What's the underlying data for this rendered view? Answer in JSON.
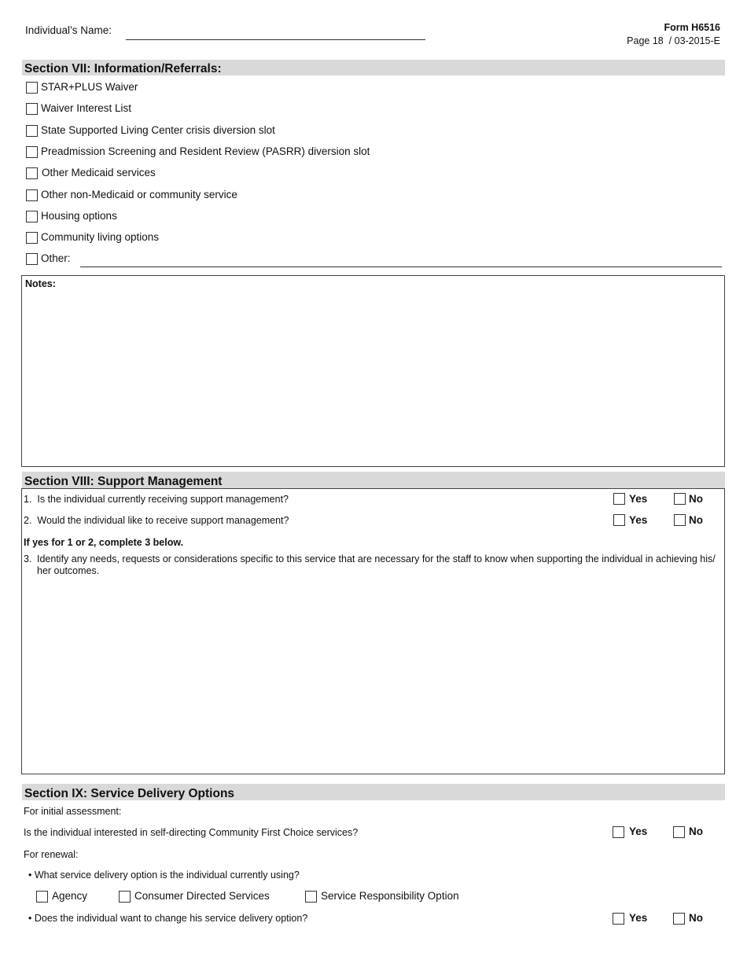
{
  "header": {
    "name_label": "Individual’s Name:",
    "name_value": "",
    "form_number": "Form H6516",
    "page_info": "Page 18  / 03-2015-E"
  },
  "section7": {
    "title": "Section VII: Information/Referrals:",
    "items": [
      {
        "label": "STAR+PLUS Waiver",
        "checked": false
      },
      {
        "label": "Waiver Interest List",
        "checked": false
      },
      {
        "label": "State Supported Living Center crisis diversion slot",
        "checked": false
      },
      {
        "label": "Preadmission Screening and Resident Review (PASRR) diversion slot",
        "checked": false
      },
      {
        "label": "Other Medicaid services",
        "checked": false
      },
      {
        "label": "Other non-Medicaid or community service",
        "checked": false
      },
      {
        "label": "Housing options",
        "checked": false
      },
      {
        "label": "Community living options",
        "checked": false
      }
    ],
    "other_label": "Other:",
    "other_value": "",
    "notes_label": "Notes:",
    "notes_value": ""
  },
  "section8": {
    "title": "Section VIII: Support Management",
    "questions": [
      {
        "text": "1.  Is the individual currently receiving support management?",
        "yes": "Yes",
        "no": "No"
      },
      {
        "text": "2.  Would the individual like to receive support management?",
        "yes": "Yes",
        "no": "No"
      }
    ],
    "instruction": "If yes for 1 or 2, complete 3 below.",
    "q3_number": "3.",
    "q3_text": "Identify any needs, requests or considerations specific to this service that are necessary for the staff to know when supporting the individual in achieving his/ her outcomes.",
    "q3_value": ""
  },
  "section9": {
    "title": "Section IX: Service Delivery Options",
    "initial_label": "For initial assessment:",
    "initial_question": "Is the individual interested in self-directing Community First Choice services?",
    "renewal_label": "For renewal:",
    "current_question": "• What service delivery option is the individual currently using?",
    "options": [
      "Agency",
      "Consumer Directed Services",
      "Service Responsibility Option"
    ],
    "change_question": "• Does the individual want to change his service delivery option?",
    "yes": "Yes",
    "no": "No"
  }
}
